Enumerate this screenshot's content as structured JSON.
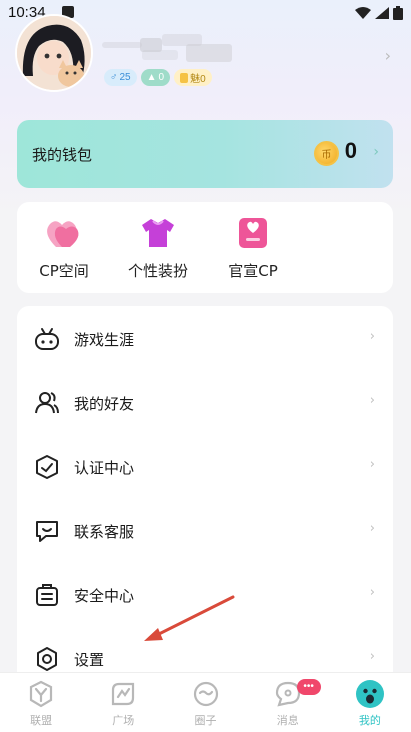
{
  "status_bar": {
    "time": "10:34"
  },
  "profile": {
    "badges": {
      "male": "25",
      "level": "0",
      "charm": "魅0"
    }
  },
  "wallet": {
    "title": "我的钱包",
    "coin_glyph": "币",
    "balance": "0"
  },
  "quick_actions": [
    {
      "label": "CP空间",
      "icon": "heart-icon",
      "color": "#f06fa0"
    },
    {
      "label": "个性装扮",
      "icon": "shirt-icon",
      "color": "#c540d8"
    },
    {
      "label": "官宣CP",
      "icon": "heart-card-icon",
      "color": "#ee5598"
    }
  ],
  "menu": [
    {
      "label": "游戏生涯",
      "icon": "gamepad-icon"
    },
    {
      "label": "我的好友",
      "icon": "friends-icon"
    },
    {
      "label": "认证中心",
      "icon": "shield-icon"
    },
    {
      "label": "联系客服",
      "icon": "chat-icon"
    },
    {
      "label": "安全中心",
      "icon": "briefcase-icon"
    },
    {
      "label": "设置",
      "icon": "gear-icon"
    }
  ],
  "tabs": [
    {
      "label": "联盟",
      "icon": "alliance-icon",
      "active": false
    },
    {
      "label": "广场",
      "icon": "square-icon",
      "active": false
    },
    {
      "label": "圈子",
      "icon": "circle-icon",
      "active": false
    },
    {
      "label": "消息",
      "icon": "message-icon",
      "active": false,
      "badge": "•••"
    },
    {
      "label": "我的",
      "icon": "me-icon",
      "active": true
    }
  ],
  "colors": {
    "accent": "#2fc3c4",
    "wallet_gradient_start": "#9ee6d9",
    "badge_red": "#f0476b",
    "annotation_arrow": "#d94a3a"
  }
}
